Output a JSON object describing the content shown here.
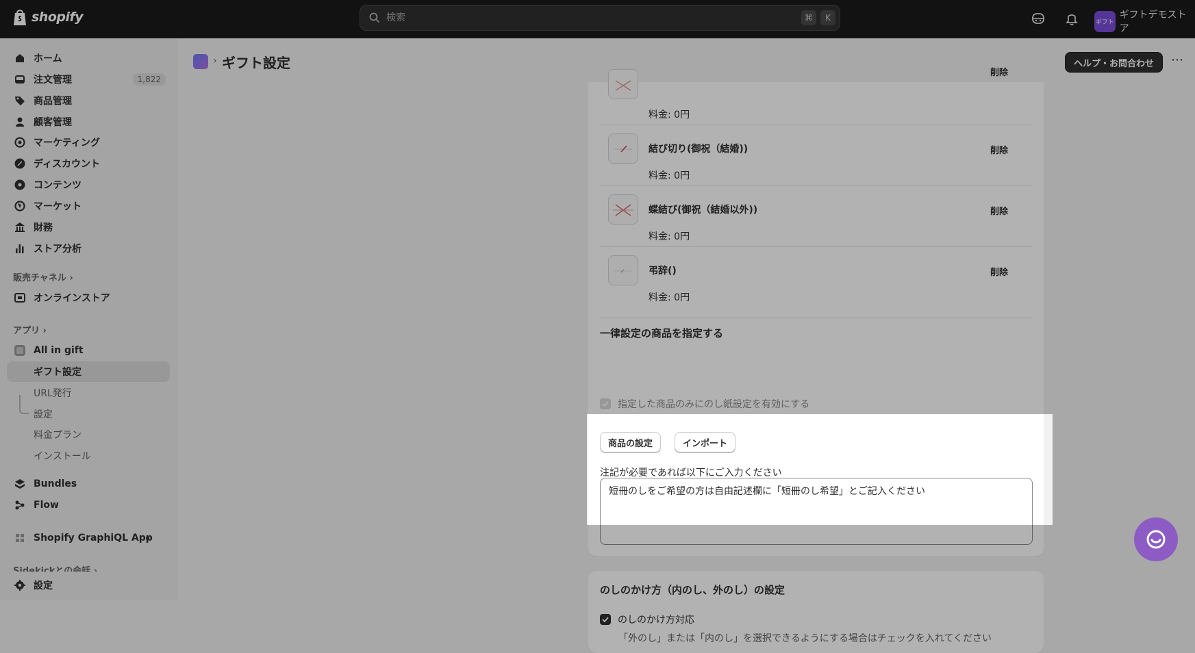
{
  "topbar": {
    "brand": "shopify",
    "search_placeholder": "検索",
    "shortcut_cmd": "⌘",
    "shortcut_key": "K",
    "store_name": "ギフトデモストア",
    "store_avatar_text": "ギフト",
    "avatar_color": "#7c4ddb"
  },
  "sidebar": {
    "items": [
      {
        "label": "ホーム",
        "icon": "home-icon"
      },
      {
        "label": "注文管理",
        "icon": "inbox-icon",
        "badge": "1,822"
      },
      {
        "label": "商品管理",
        "icon": "tag-icon"
      },
      {
        "label": "顧客管理",
        "icon": "person-icon"
      },
      {
        "label": "マーケティング",
        "icon": "target-icon"
      },
      {
        "label": "ディスカウント",
        "icon": "discount-icon"
      },
      {
        "label": "コンテンツ",
        "icon": "content-icon"
      },
      {
        "label": "マーケット",
        "icon": "globe-icon"
      },
      {
        "label": "財務",
        "icon": "bank-icon"
      },
      {
        "label": "ストア分析",
        "icon": "chart-icon"
      }
    ],
    "sales_channels_heading": "販売チャネル",
    "online_store": "オンラインストア",
    "apps_heading": "アプリ",
    "app_name": "All in gift",
    "app_subitems": [
      "ギフト設定",
      "URL発行",
      "設定",
      "料金プラン",
      "インストール"
    ],
    "bundles": "Bundles",
    "flow": "Flow",
    "graphiql": "Shopify GraphiQL App",
    "sidekick": "Sidekickとの会話",
    "settings": "設定"
  },
  "header": {
    "title": "ギフト設定",
    "help_button": "ヘルプ・お問合わせ",
    "more_label": "⋯"
  },
  "noshi_rows": [
    {
      "name": "",
      "price": "料金: 0円",
      "delete": "削除"
    },
    {
      "name": "結び切り(御祝（結婚))",
      "price": "料金: 0円",
      "delete": "削除"
    },
    {
      "name": "蝶結び(御祝（結婚以外))",
      "price": "料金: 0円",
      "delete": "削除"
    },
    {
      "name": "弔辞()",
      "price": "料金: 0円",
      "delete": "削除"
    }
  ],
  "uniform": {
    "title": "一律設定の商品を指定する",
    "checkbox_label": "指定した商品のみにのし紙設定を有効にする",
    "product_settings_button": "商品の設定",
    "import_button": "インポート"
  },
  "note": {
    "label": "注記が必要であれば以下にご入力ください",
    "value": "短冊のしをご希望の方は自由記述欄に「短冊のし希望」とご記入ください"
  },
  "wrapping": {
    "title": "のしのかけ方（内のし、外のし）の設定",
    "checkbox_label": "のしのかけ方対応",
    "help_text": "「外のし」または「内のし」を選択できるようにする場合はチェックを入れてください"
  },
  "colors": {
    "accent_purple": "#8c5cc4",
    "topbar": "#1a1a1a"
  }
}
